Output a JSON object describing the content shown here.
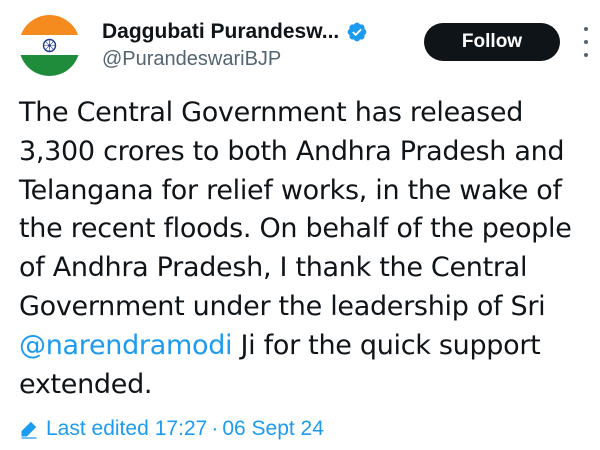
{
  "author": {
    "display_name": "Daggubati Purandesw...",
    "handle": "@PurandeswariBJP",
    "verified": true,
    "avatar": "indian-flag-avatar"
  },
  "actions": {
    "follow_label": "Follow",
    "more_icon": "more-vertical-icon"
  },
  "tweet": {
    "lines": [
      "The Central Government has released",
      "3,300 crores to both Andhra Pradesh and",
      "Telangana for relief works, in the wake of",
      "the recent floods. On behalf of the people",
      "of Andhra Pradesh, I thank the Central",
      "Government under the leadership of Sri"
    ],
    "mention": "@narendramodi",
    "after_mention": " Ji for the quick support",
    "last_line": "extended."
  },
  "edit_info": {
    "label": "Last edited",
    "time": "17:27",
    "separator": "·",
    "date": "06 Sept 24"
  },
  "colors": {
    "text": "#0f1419",
    "secondary": "#536471",
    "link": "#1d9bf0",
    "button_bg": "#0f1419"
  }
}
